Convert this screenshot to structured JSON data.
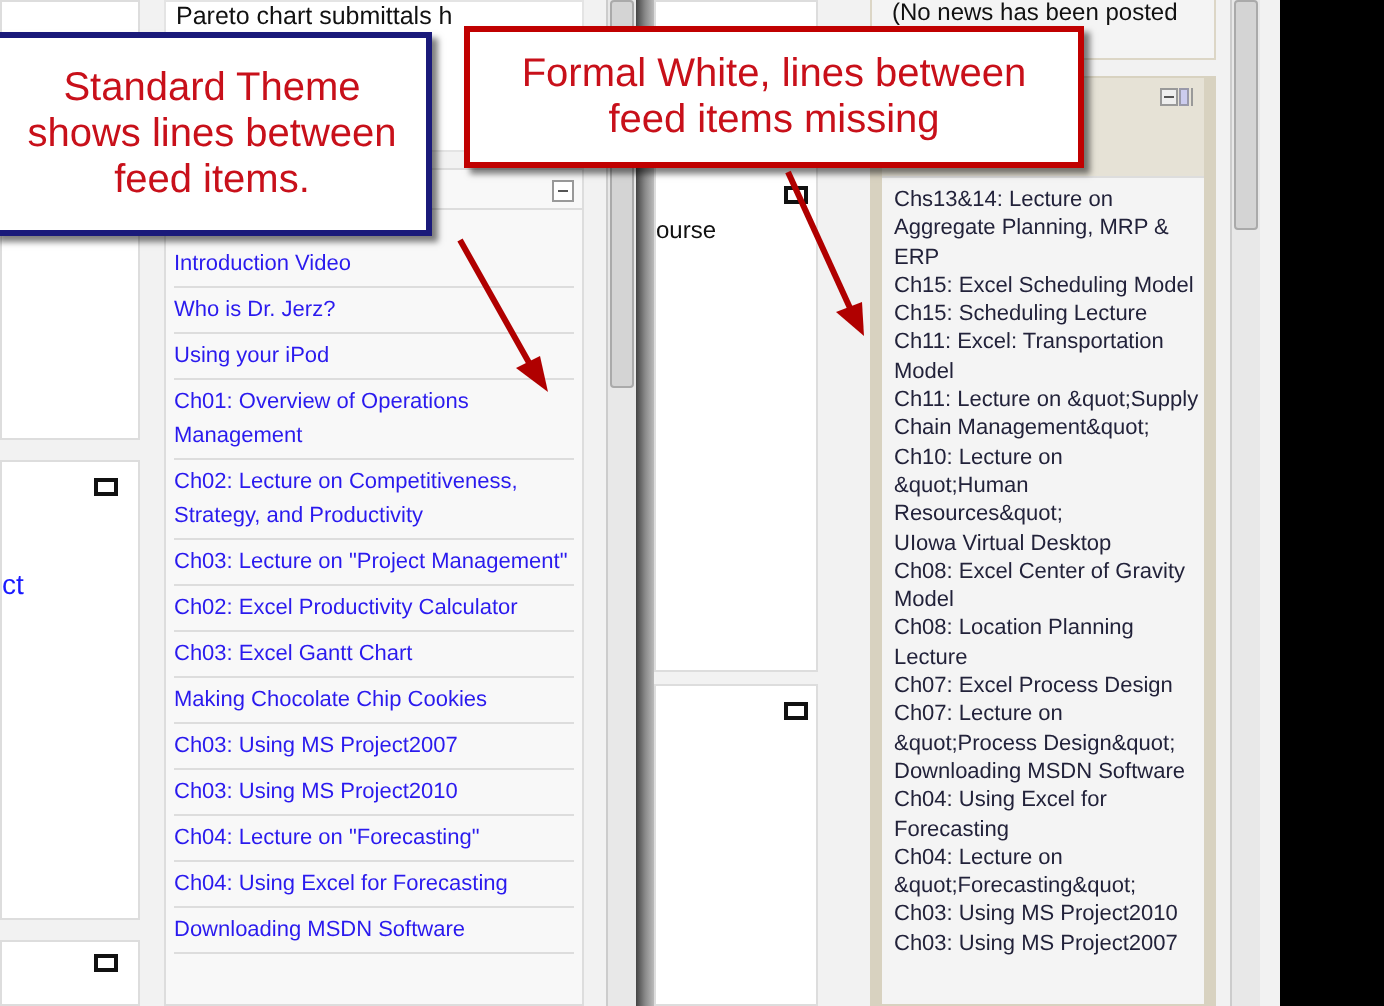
{
  "left_window": {
    "news_text": "Pareto chart submittals h",
    "side_text": "ct",
    "feed_items": [
      "Introduction Video",
      "Who is Dr. Jerz?",
      "Using your iPod",
      "Ch01: Overview of Operations Management",
      "Ch02: Lecture on Competitiveness, Strategy, and Productivity",
      "Ch03: Lecture on \"Project Management\"",
      "Ch02: Excel Productivity Calculator",
      "Ch03: Excel Gantt Chart",
      "Making Chocolate Chip Cookies",
      "Ch03: Using MS Project2007",
      "Ch03: Using MS Project2010",
      "Ch04: Lecture on \"Forecasting\"",
      "Ch04: Using Excel for Forecasting",
      "Downloading MSDN Software"
    ]
  },
  "right_window": {
    "content_text": "ourse",
    "news_text": "(No news has been posted",
    "feed_items": [
      "Chs13&14: Lecture on Aggregate Planning, MRP & ERP",
      "Ch15: Excel Scheduling Model",
      "Ch15: Scheduling Lecture",
      "Ch11: Excel: Transportation Model",
      "Ch11: Lecture on &quot;Supply Chain Management&quot;",
      "Ch10: Lecture on &quot;Human Resources&quot;",
      "UIowa Virtual Desktop",
      "Ch08: Excel Center of Gravity Model",
      "Ch08: Location Planning Lecture",
      "Ch07: Excel Process Design",
      "Ch07: Lecture on &quot;Process Design&quot;",
      "Downloading MSDN Software",
      "Ch04: Using Excel for Forecasting",
      "Ch04: Lecture on &quot;Forecasting&quot;",
      "Ch03: Using MS Project2010",
      "Ch03: Using MS Project2007"
    ]
  },
  "callouts": [
    {
      "text": "Standard Theme shows lines between feed items.",
      "color": "#1a1a7a"
    },
    {
      "text": "Formal White, lines between feed items missing",
      "color": "#c00000"
    }
  ]
}
